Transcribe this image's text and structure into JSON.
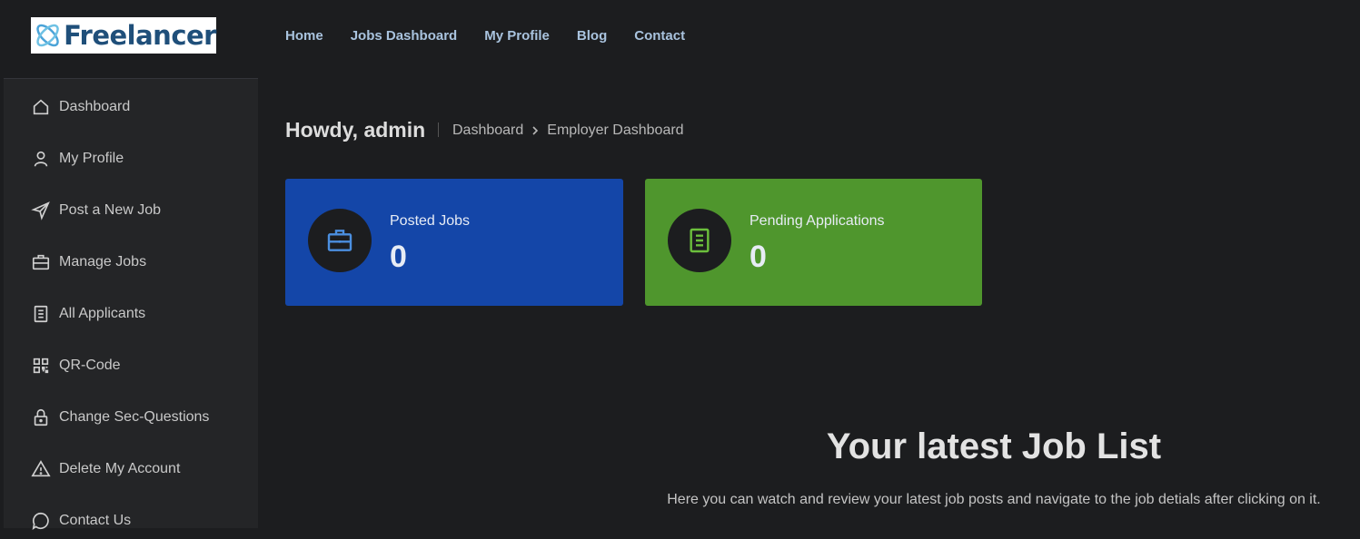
{
  "logo": {
    "text": "Freelancer"
  },
  "nav": [
    "Home",
    "Jobs Dashboard",
    "My Profile",
    "Blog",
    "Contact"
  ],
  "sidebar": {
    "items": [
      {
        "label": "Dashboard",
        "icon": "home-icon"
      },
      {
        "label": "My Profile",
        "icon": "user-icon"
      },
      {
        "label": "Post a New Job",
        "icon": "send-icon"
      },
      {
        "label": "Manage Jobs",
        "icon": "briefcase-icon"
      },
      {
        "label": "All Applicants",
        "icon": "document-icon"
      },
      {
        "label": "QR-Code",
        "icon": "qr-icon"
      },
      {
        "label": "Change Sec-Questions",
        "icon": "lock-icon"
      },
      {
        "label": "Delete My Account",
        "icon": "warning-icon"
      },
      {
        "label": "Contact Us",
        "icon": "chat-icon"
      }
    ]
  },
  "header": {
    "greeting": "Howdy, admin",
    "breadcrumb": [
      "Dashboard",
      "Employer Dashboard"
    ]
  },
  "cards": [
    {
      "label": "Posted Jobs",
      "value": "0",
      "color": "#1446a8",
      "icon": "briefcase-icon"
    },
    {
      "label": "Pending Applications",
      "value": "0",
      "color": "#4f962d",
      "icon": "document-icon"
    }
  ],
  "latest": {
    "title": "Your latest Job List",
    "subtitle": "Here you can watch and review your latest job posts and navigate to the job detials after clicking on it."
  }
}
